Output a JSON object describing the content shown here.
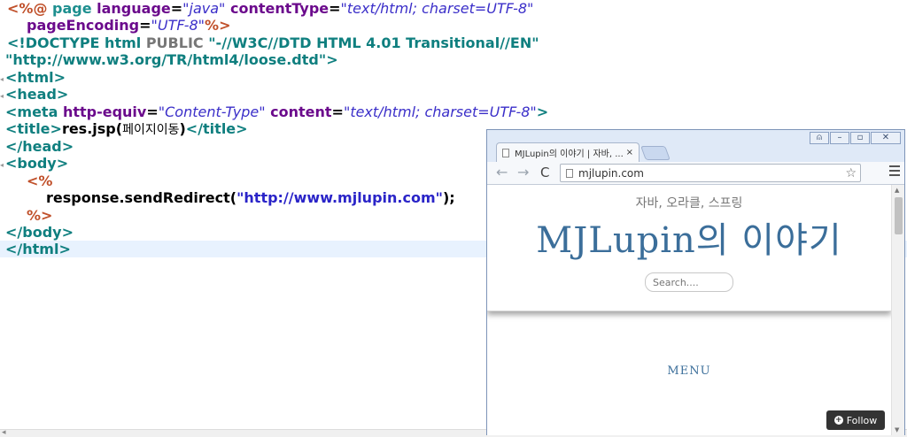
{
  "editor": {
    "l1": {
      "open": "<%@",
      "page": " page",
      "language": " language",
      "eq": "=",
      "language_val": "\"java\"",
      "contentType": " contentType",
      "contentType_val": "\"text/html; charset=UTF-8\""
    },
    "l2": {
      "pageEncoding": "pageEncoding",
      "eq": "=",
      "pageEncoding_val": "\"UTF-8\"",
      "close": "%>"
    },
    "l3": {
      "doctype": "<!DOCTYPE html ",
      "public": "PUBLIC",
      "dtd": " \"-//W3C//DTD HTML 4.01 Transitional//EN\""
    },
    "l4": {
      "dtd_url": "\"http://www.w3.org/TR/html4/loose.dtd\">"
    },
    "l5": "<html>",
    "l6": "<head>",
    "l7": {
      "meta_open": "<meta ",
      "http_equiv": "http-equiv",
      "eq": "=",
      "http_equiv_val": "\"Content-Type\"",
      "content": " content",
      "content_val": "\"text/html; charset=UTF-8\"",
      "close": ">"
    },
    "l8": {
      "title_open": "<title>",
      "title_text": "res.jsp(",
      "title_kor": "페이지이동",
      "title_paren": ")",
      "title_close": "</title>"
    },
    "l9": "</head>",
    "l10": "<body>",
    "l11": "<%",
    "l12": {
      "call": "response.sendRedirect(",
      "url": "\"http://www.mjlupin.com\"",
      "end": ");"
    },
    "l13": "%>",
    "l14": "</body>",
    "l15": "</html>"
  },
  "browser": {
    "tab_title": "MJLupin의 이야기 | 자바, ...",
    "tab_close": "×",
    "url": "mjlupin.com",
    "back": "←",
    "forward": "→",
    "reload": "C",
    "star": "☆",
    "window_buttons": {
      "user": "⍝",
      "minimize": "–",
      "maximize": "▫",
      "close": "✕"
    }
  },
  "site": {
    "tagline": "자바, 오라클, 스프링",
    "title": "MJLupin의 이야기",
    "search_placeholder": "Search....",
    "menu": "MENU",
    "follow": "Follow",
    "follow_icon": "+"
  }
}
